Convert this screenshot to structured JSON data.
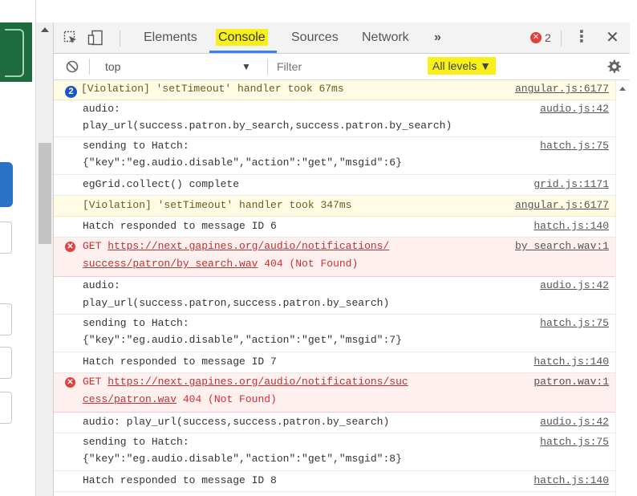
{
  "devtools": {
    "tabs": [
      "Elements",
      "Console",
      "Sources",
      "Network"
    ],
    "more_tabs": "»",
    "error_count": "2",
    "toolbar": {
      "context": "top",
      "filter_placeholder": "Filter",
      "levels": "All levels ▼"
    }
  },
  "console": {
    "entries": [
      {
        "type": "warn",
        "count": "2",
        "lines": [
          "[Violation] 'setTimeout' handler took 67ms"
        ],
        "source": "angular.js:6177"
      },
      {
        "type": "log",
        "lines": [
          "audio:",
          "play_url(success.patron.by_search,success.patron.by_search)"
        ],
        "source": "audio.js:42"
      },
      {
        "type": "log",
        "lines": [
          "sending to Hatch:",
          "{\"key\":\"eg.audio.disable\",\"action\":\"get\",\"msgid\":6}"
        ],
        "source": "hatch.js:75"
      },
      {
        "type": "log",
        "lines": [
          "egGrid.collect() complete"
        ],
        "source": "grid.js:1171"
      },
      {
        "type": "warn",
        "lines": [
          "[Violation] 'setTimeout' handler took 347ms"
        ],
        "source": "angular.js:6177"
      },
      {
        "type": "log",
        "lines": [
          "Hatch responded to message ID 6"
        ],
        "source": "hatch.js:140"
      },
      {
        "type": "error",
        "method": "GET",
        "url1": "https://next.gapines.org/audio/notifications/",
        "url2": "success/patron/by_search.wav",
        "status": "404 (Not Found)",
        "source": "by_search.wav:1"
      },
      {
        "type": "log",
        "lines": [
          "audio:",
          "play_url(success.patron,success.patron.by_search)"
        ],
        "source": "audio.js:42"
      },
      {
        "type": "log",
        "lines": [
          "sending to Hatch:",
          "{\"key\":\"eg.audio.disable\",\"action\":\"get\",\"msgid\":7}"
        ],
        "source": "hatch.js:75"
      },
      {
        "type": "log",
        "lines": [
          "Hatch responded to message ID 7"
        ],
        "source": "hatch.js:140"
      },
      {
        "type": "error",
        "method": "GET",
        "url1": "https://next.gapines.org/audio/notifications/suc",
        "url2": "cess/patron.wav",
        "status": "404 (Not Found)",
        "source": "patron.wav:1"
      },
      {
        "type": "log",
        "lines": [
          "audio: play_url(success,success.patron.by_search)"
        ],
        "source": "audio.js:42"
      },
      {
        "type": "log",
        "lines": [
          "sending to Hatch:",
          "{\"key\":\"eg.audio.disable\",\"action\":\"get\",\"msgid\":8}"
        ],
        "source": "hatch.js:75"
      },
      {
        "type": "log",
        "lines": [
          "Hatch responded to message ID 8"
        ],
        "source": "hatch.js:140"
      }
    ]
  }
}
